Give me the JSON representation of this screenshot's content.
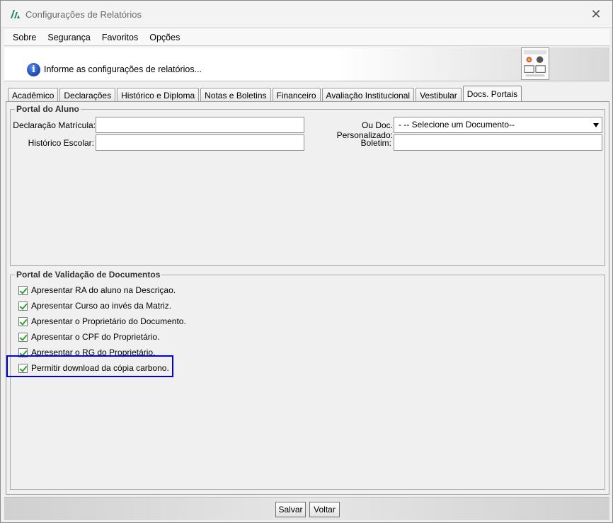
{
  "window": {
    "title": "Configurações de Relatórios",
    "close_glyph": "✕"
  },
  "menu": {
    "items": [
      "Sobre",
      "Segurança",
      "Favoritos",
      "Opções"
    ]
  },
  "info": {
    "text": "Informe as configurações de relatórios..."
  },
  "tabs": [
    {
      "label": "Acadêmico"
    },
    {
      "label": "Declarações"
    },
    {
      "label": "Histórico e Diploma"
    },
    {
      "label": "Notas e Boletins"
    },
    {
      "label": "Financeiro"
    },
    {
      "label": "Avaliação Institucional"
    },
    {
      "label": "Vestibular"
    },
    {
      "label": "Docs. Portais"
    }
  ],
  "active_tab": "Docs. Portais",
  "portal_aluno": {
    "title": "Portal do Aluno",
    "declaracao_label": "Declaração Matrícula:",
    "declaracao_value": "",
    "doc_personalizado_label": "Ou Doc. Personalizado:",
    "doc_personalizado_selected": "- -- Selecione um Documento--",
    "historico_label": "Histórico Escolar:",
    "historico_value": "",
    "boletim_label": "Boletim:",
    "boletim_value": ""
  },
  "portal_validacao": {
    "title": "Portal de Validação de Documentos",
    "options": [
      {
        "label": "Apresentar RA do aluno na Descriçao.",
        "checked": true
      },
      {
        "label": "Apresentar Curso ao invés da Matriz.",
        "checked": true
      },
      {
        "label": "Apresentar o Proprietário do Documento.",
        "checked": true
      },
      {
        "label": "Apresentar o CPF do Proprietário.",
        "checked": true
      },
      {
        "label": "Apresentar o RG do Proprietário.",
        "checked": true
      },
      {
        "label": "Permitir download da cópia carbono.",
        "checked": true
      }
    ]
  },
  "buttons": {
    "save": "Salvar",
    "back": "Voltar"
  },
  "colors": {
    "highlight": "#0000e0",
    "check": "#2aa52a",
    "info_icon": "#1d4fb8"
  }
}
